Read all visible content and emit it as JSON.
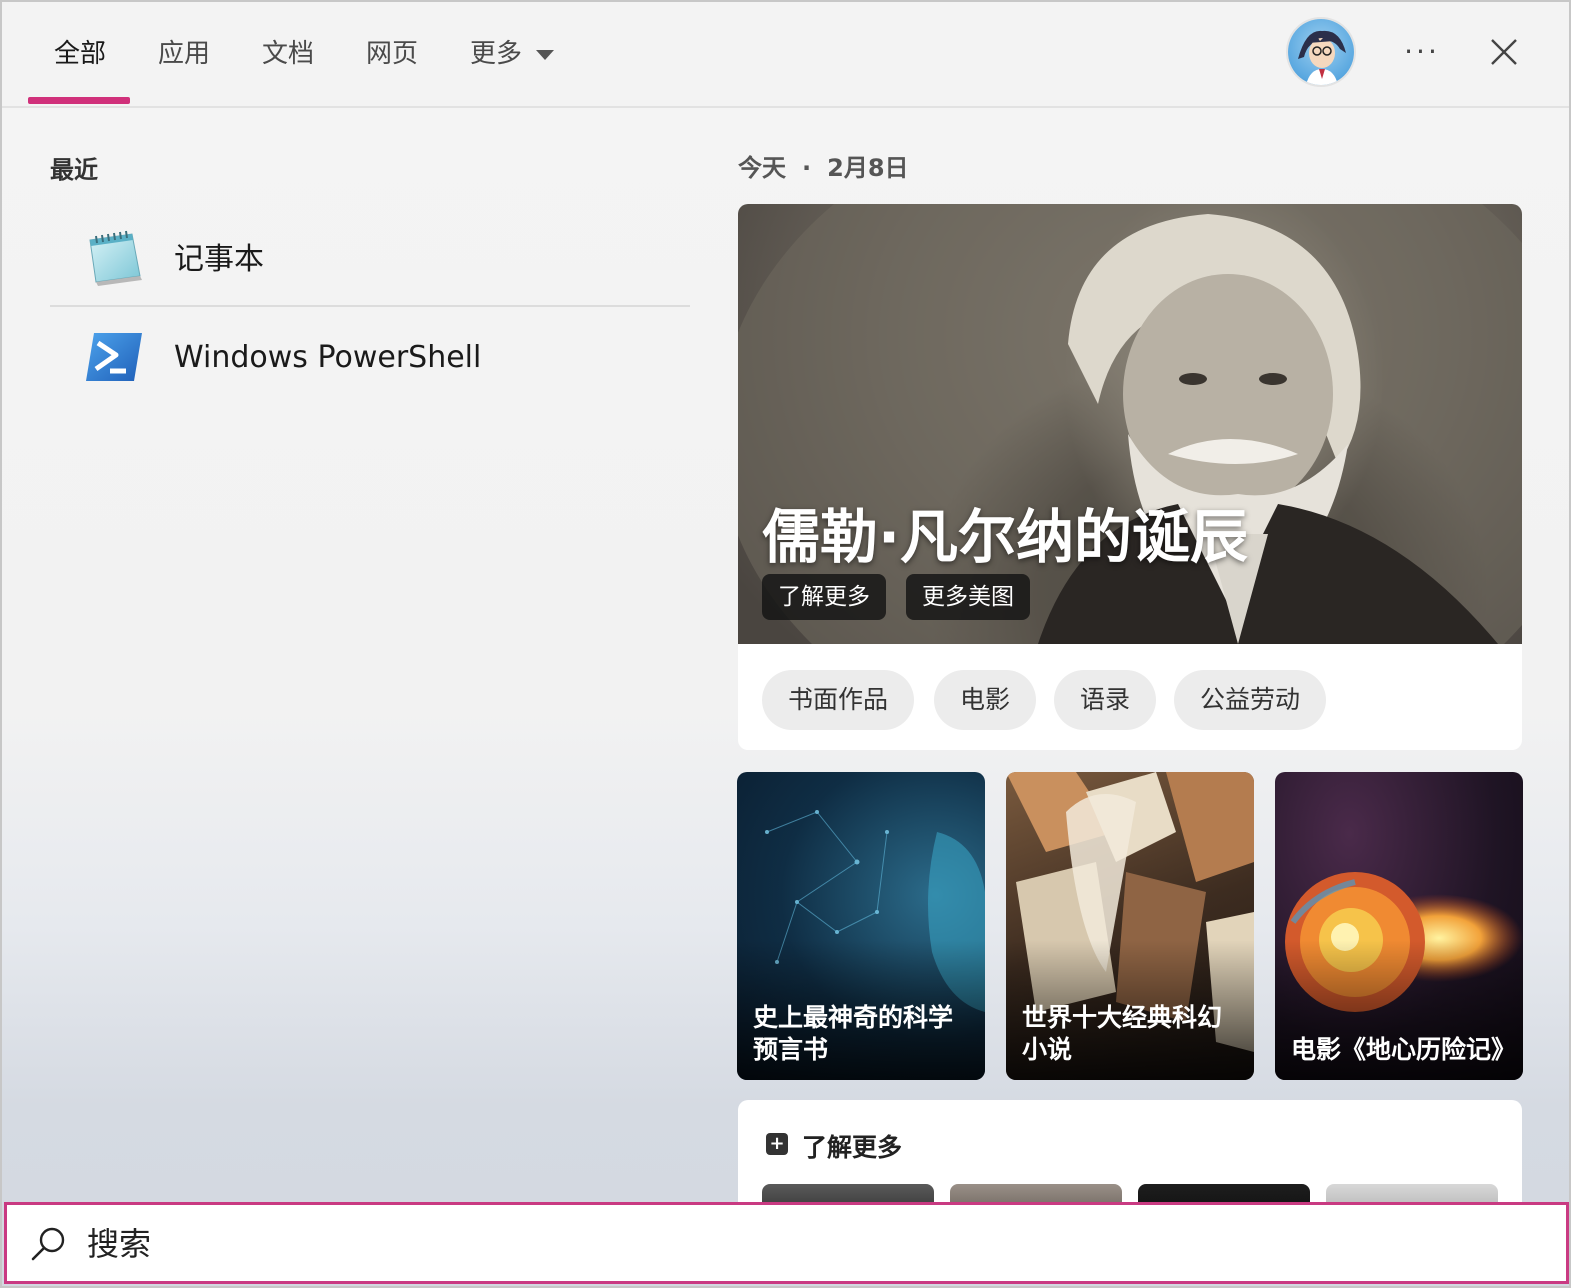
{
  "tabs": [
    {
      "label": "全部"
    },
    {
      "label": "应用"
    },
    {
      "label": "文档"
    },
    {
      "label": "网页"
    },
    {
      "label": "更多"
    }
  ],
  "header": {
    "more_options_label": "···"
  },
  "recent": {
    "title": "最近",
    "items": [
      {
        "label": "记事本",
        "icon": "notepad-icon"
      },
      {
        "label": "Windows PowerShell",
        "icon": "powershell-icon"
      }
    ]
  },
  "today": {
    "label": "今天",
    "date": "2月8日"
  },
  "hero": {
    "title": "儒勒·凡尔纳的诞辰",
    "learn_more": "了解更多",
    "more_images": "更多美图",
    "chips": [
      "书面作品",
      "电影",
      "语录",
      "公益劳动"
    ]
  },
  "tiles": [
    {
      "caption": "史上最神奇的科学预言书"
    },
    {
      "caption": "世界十大经典科幻小说"
    },
    {
      "caption": "电影《地心历险记》"
    }
  ],
  "learn_more_section": {
    "title": "了解更多"
  },
  "search": {
    "placeholder": "搜索"
  },
  "colors": {
    "accent": "#d0307a",
    "search_border": "#c93a82"
  }
}
